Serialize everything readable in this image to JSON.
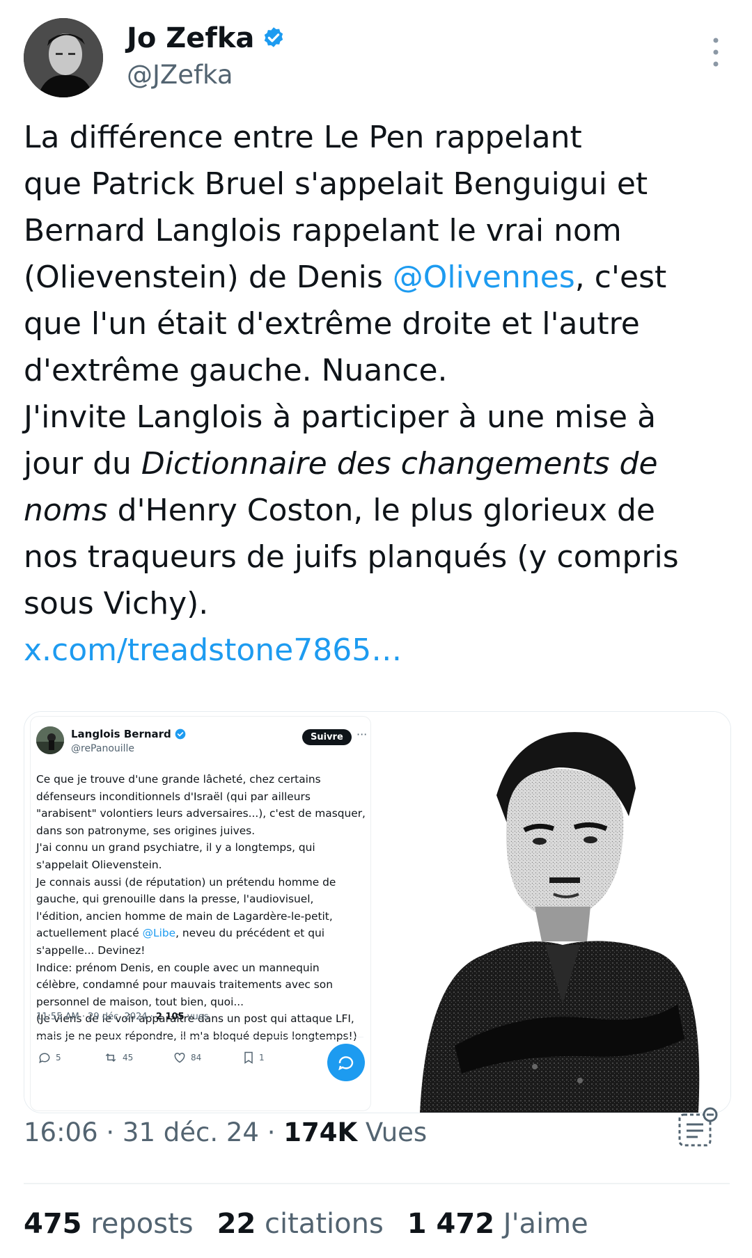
{
  "author": {
    "name": "Jo Zefka",
    "handle": "@JZefka",
    "verified": true
  },
  "tweet": {
    "lines": [
      {
        "parts": [
          {
            "text": "La différence entre Le Pen rappelant"
          }
        ]
      },
      {
        "parts": [
          {
            "text": "que Patrick Bruel s'appelait Benguigui et"
          }
        ]
      },
      {
        "parts": [
          {
            "text": "Bernard Langlois rappelant le vrai nom"
          }
        ]
      },
      {
        "parts": [
          {
            "text": "(Olievenstein) de Denis "
          },
          {
            "text": "@Olivennes",
            "kind": "mention"
          },
          {
            "text": ", c'est"
          }
        ]
      },
      {
        "parts": [
          {
            "text": "que l'un était d'extrême droite et l'autre"
          }
        ]
      },
      {
        "parts": [
          {
            "text": "d'extrême gauche. Nuance."
          }
        ]
      },
      {
        "parts": [
          {
            "text": "J'invite Langlois à participer à une mise à"
          }
        ]
      },
      {
        "parts": [
          {
            "text": "jour du "
          },
          {
            "text": "Dictionnaire des changements de",
            "kind": "italic"
          }
        ]
      },
      {
        "parts": [
          {
            "text": "noms",
            "kind": "italic"
          },
          {
            "text": " d'Henry Coston, le plus glorieux de"
          }
        ]
      },
      {
        "parts": [
          {
            "text": "nos traqueurs de juifs planqués (y compris"
          }
        ]
      },
      {
        "parts": [
          {
            "text": "sous Vichy)."
          }
        ]
      },
      {
        "parts": [
          {
            "text": "x.com/treadstone7865…",
            "kind": "link"
          }
        ]
      }
    ]
  },
  "quoted_screenshot": {
    "name": "Langlois Bernard",
    "handle": "@rePanouille",
    "follow_label": "Suivre",
    "more_label": "···",
    "lines": [
      {
        "parts": [
          {
            "text": "Ce que je trouve d'une grande lâcheté, chez certains"
          }
        ]
      },
      {
        "parts": [
          {
            "text": "défenseurs inconditionnels d'Israël (qui par ailleurs"
          }
        ]
      },
      {
        "parts": [
          {
            "text": "\"arabisent\" volontiers leurs adversaires...), c'est de masquer,"
          }
        ]
      },
      {
        "parts": [
          {
            "text": "dans son patronyme, ses origines juives."
          }
        ]
      },
      {
        "parts": [
          {
            "text": "J'ai connu un grand psychiatre, il y a longtemps, qui"
          }
        ]
      },
      {
        "parts": [
          {
            "text": "s'appelait Olievenstein."
          }
        ]
      },
      {
        "parts": [
          {
            "text": "Je connais aussi (de réputation) un prétendu homme de"
          }
        ]
      },
      {
        "parts": [
          {
            "text": "gauche, qui grenouille dans la presse, l'audiovisuel,"
          }
        ]
      },
      {
        "parts": [
          {
            "text": "l'édition, ancien homme de main de Lagardère-le-petit,"
          }
        ]
      },
      {
        "parts": [
          {
            "text": "actuellement placé "
          },
          {
            "text": "@Libe",
            "kind": "mention"
          },
          {
            "text": ", neveu du précédent et qui"
          }
        ]
      },
      {
        "parts": [
          {
            "text": "s'appelle... Devinez!"
          }
        ]
      },
      {
        "parts": [
          {
            "text": "Indice: prénom Denis, en couple avec un mannequin"
          }
        ]
      },
      {
        "parts": [
          {
            "text": "célèbre, condamné pour mauvais traitements avec son"
          }
        ]
      },
      {
        "parts": [
          {
            "text": "personnel de maison, tout bien, quoi..."
          }
        ]
      },
      {
        "parts": [
          {
            "text": "(Je viens de le voir apparaître dans un post qui attaque LFI,"
          }
        ]
      },
      {
        "parts": [
          {
            "text": "mais je ne peux répondre, il m'a bloqué depuis longtemps!)"
          }
        ]
      }
    ],
    "time": "11:55 AM · 29 déc. 2024 · ",
    "views_count": "2 105",
    "views_label": " vues",
    "replies": "5",
    "reposts": "45",
    "likes": "84",
    "bookmarks": "1"
  },
  "meta": {
    "time": "16:06 · 31 déc. 24 · ",
    "views_count": "174K",
    "views_label": " Vues"
  },
  "stats": {
    "reposts_count": "475",
    "reposts_label": "reposts",
    "quotes_count": "22",
    "quotes_label": "citations",
    "likes_count": "1 472",
    "likes_label": "J'aime"
  },
  "colors": {
    "accent": "#1d9bf0",
    "text": "#0f1419",
    "secondary": "#536471"
  }
}
